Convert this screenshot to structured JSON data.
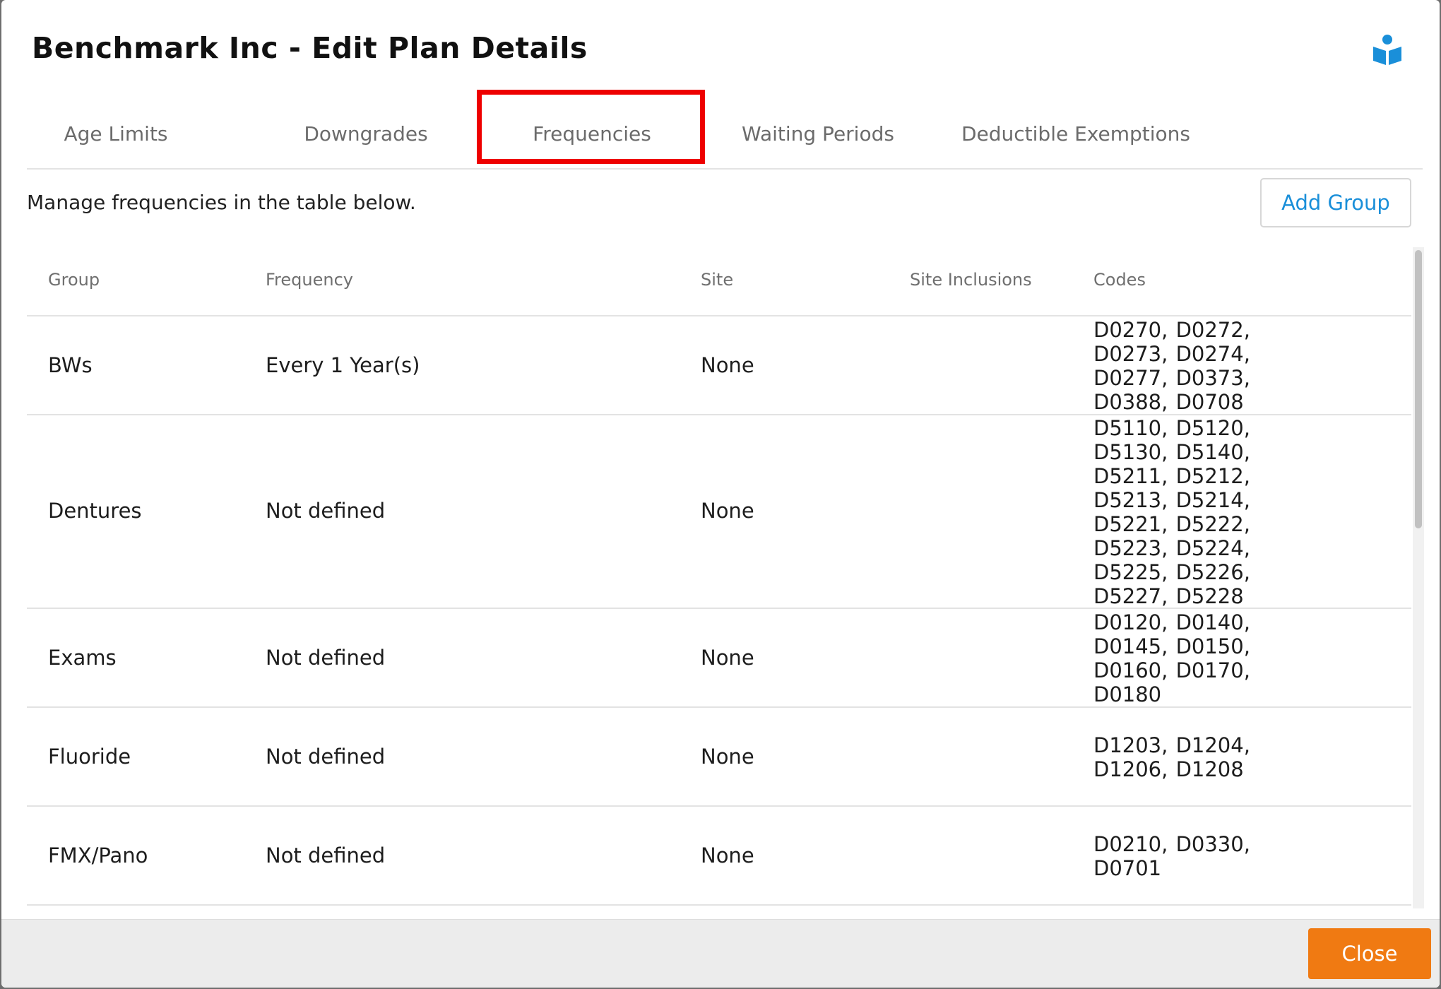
{
  "dialog": {
    "title": "Benchmark Inc - Edit Plan Details",
    "help_icon": "help-book-icon",
    "accent_color": "#1a8fd9"
  },
  "tabs": [
    {
      "label": "Age Limits",
      "active": false
    },
    {
      "label": "Downgrades",
      "active": false
    },
    {
      "label": "Frequencies",
      "active": true
    },
    {
      "label": "Waiting Periods",
      "active": false
    },
    {
      "label": "Deductible Exemptions",
      "active": false
    }
  ],
  "highlight_color": "#ee0000",
  "content": {
    "instructions": "Manage frequencies in the table below.",
    "add_group_label": "Add Group"
  },
  "table": {
    "headers": {
      "group": "Group",
      "frequency": "Frequency",
      "site": "Site",
      "site_inclusions": "Site Inclusions",
      "codes": "Codes"
    },
    "rows": [
      {
        "group": "BWs",
        "frequency": "Every 1 Year(s)",
        "site": "None",
        "site_inclusions": "",
        "codes": "D0270, D0272, D0273, D0274, D0277, D0373, D0388, D0708"
      },
      {
        "group": "Dentures",
        "frequency": "Not defined",
        "site": "None",
        "site_inclusions": "",
        "codes": "D5110, D5120, D5130, D5140, D5211, D5212, D5213, D5214, D5221, D5222, D5223, D5224, D5225, D5226, D5227, D5228"
      },
      {
        "group": "Exams",
        "frequency": "Not defined",
        "site": "None",
        "site_inclusions": "",
        "codes": "D0120, D0140, D0145, D0150, D0160, D0170, D0180"
      },
      {
        "group": "Fluoride",
        "frequency": "Not defined",
        "site": "None",
        "site_inclusions": "",
        "codes": "D1203, D1204, D1206, D1208"
      },
      {
        "group": "FMX/Pano",
        "frequency": "Not defined",
        "site": "None",
        "site_inclusions": "",
        "codes": "D0210, D0330, D0701"
      }
    ]
  },
  "footer": {
    "close_label": "Close",
    "close_color": "#f07a12"
  }
}
